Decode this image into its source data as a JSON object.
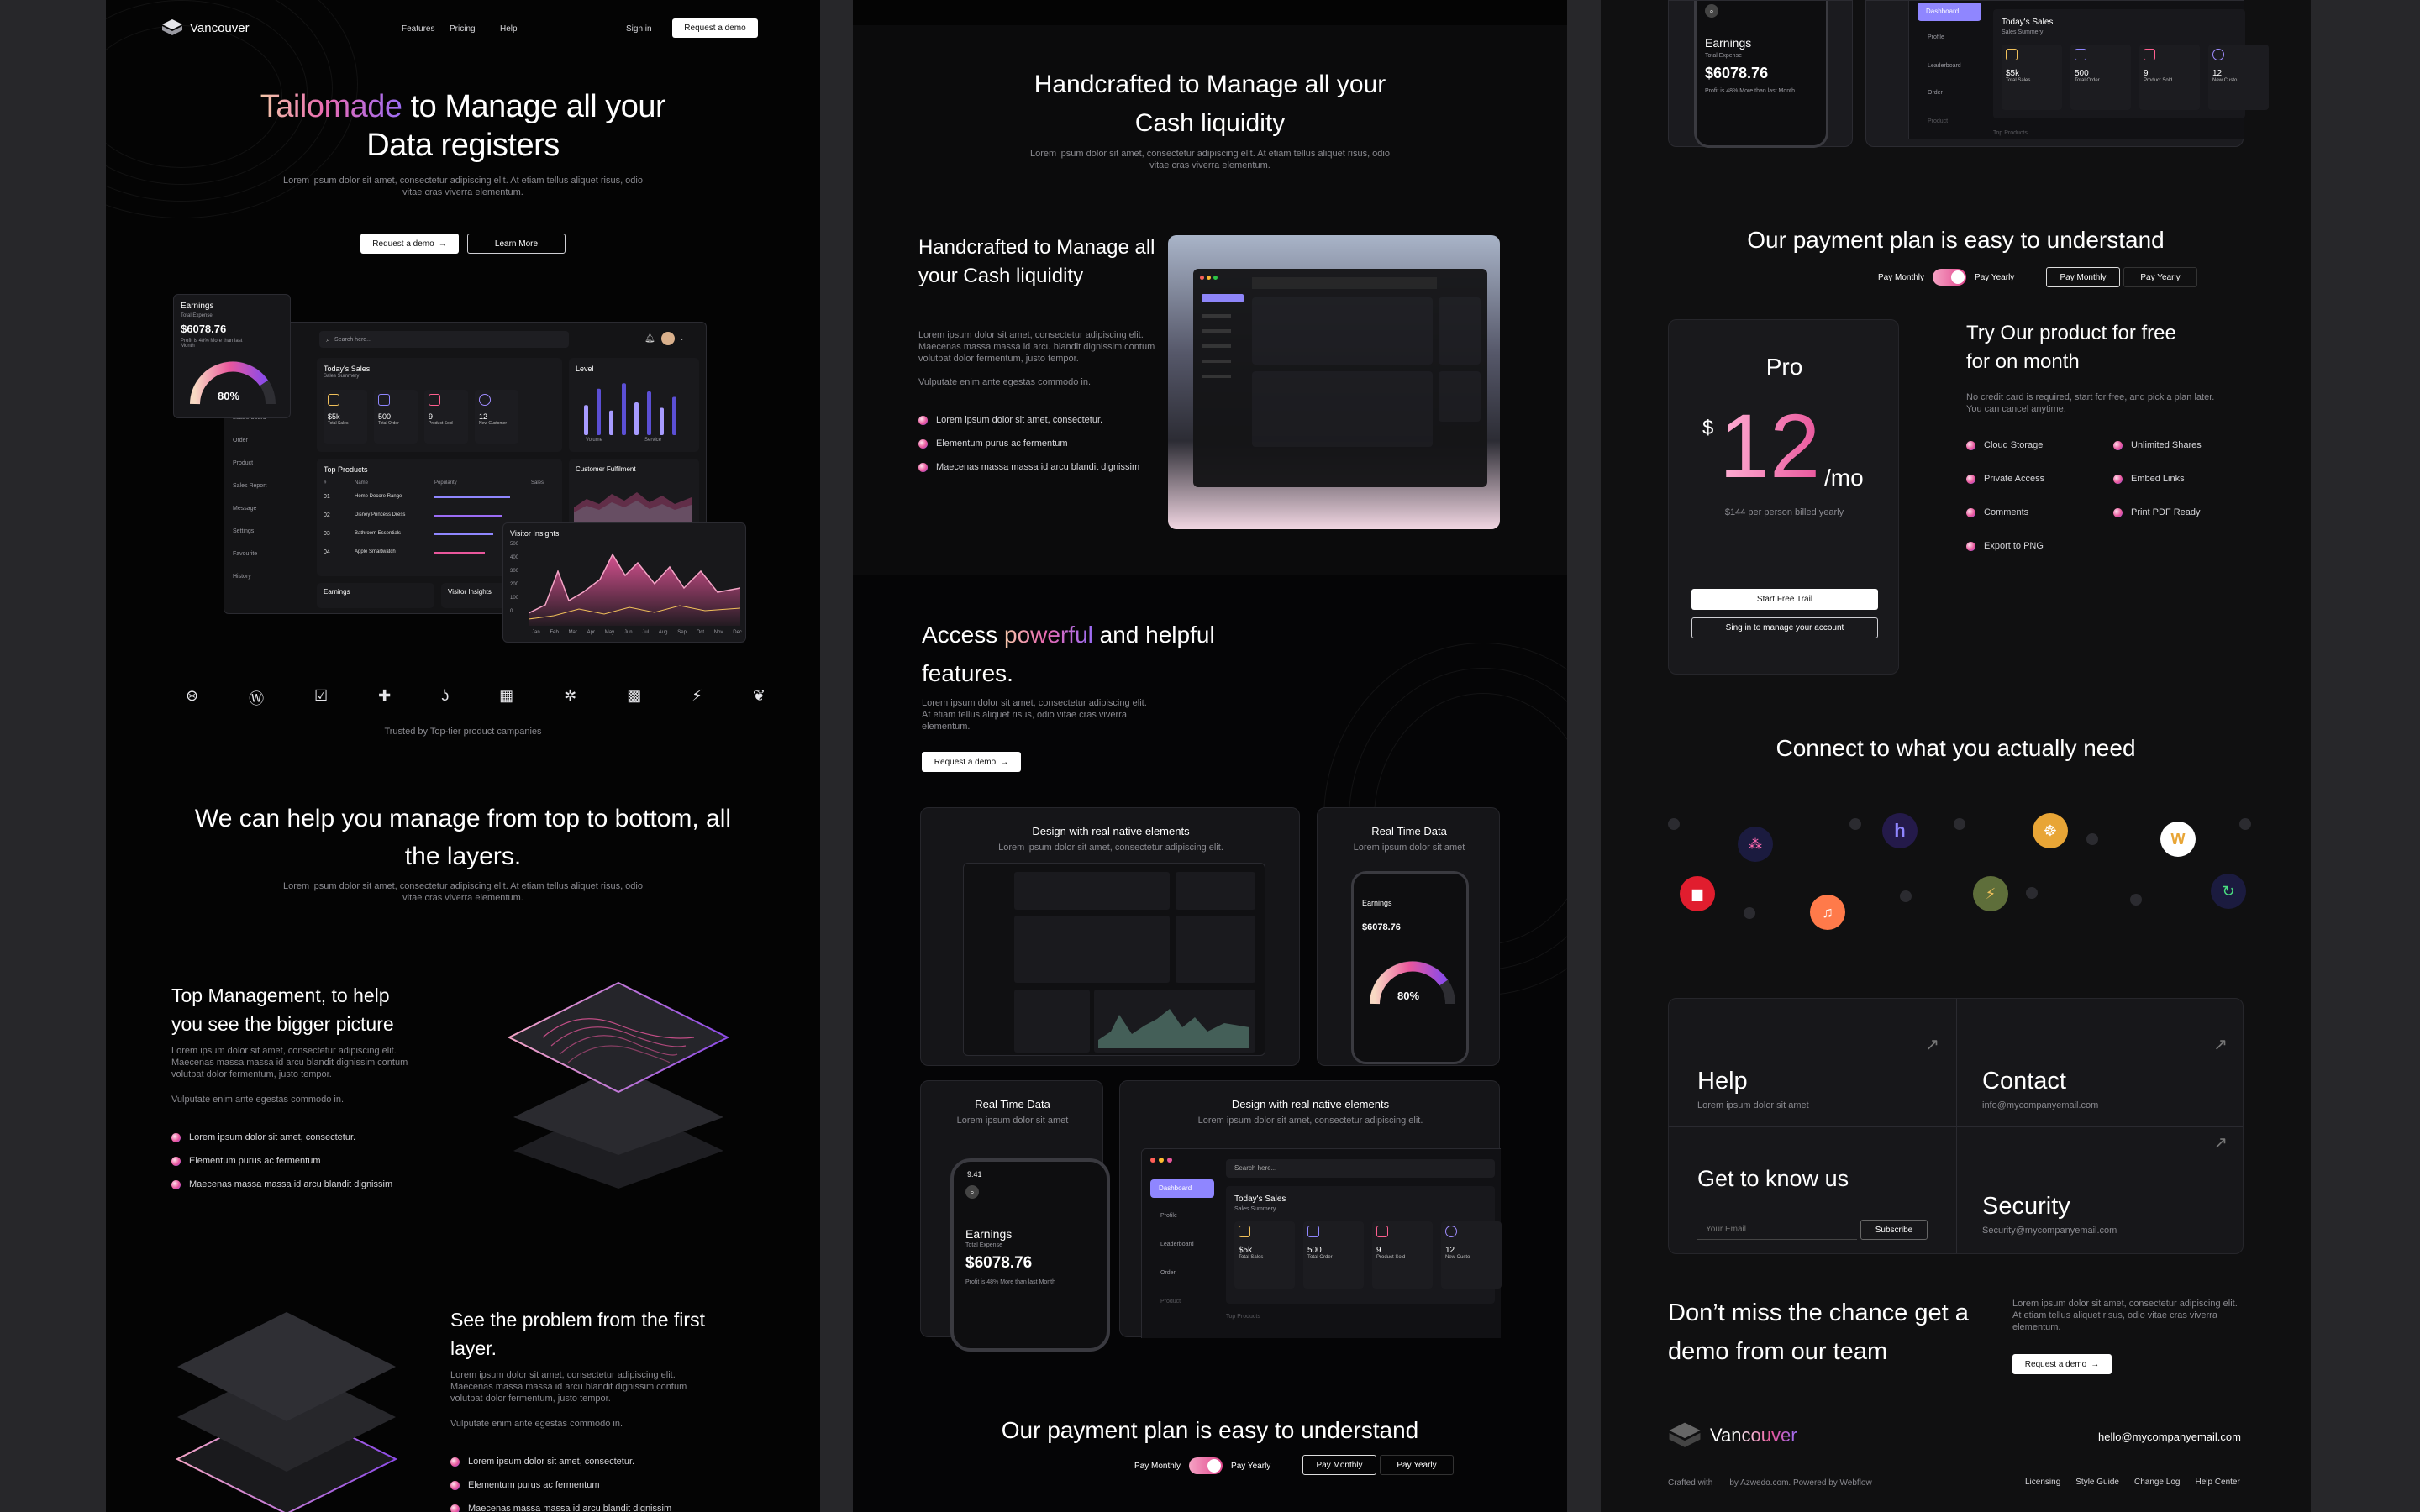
{
  "col1": {
    "nav": {
      "brand": "Vancouver",
      "links": [
        "Features",
        "Pricing",
        "Help"
      ],
      "signin": "Sign in",
      "demo": "Request a demo"
    },
    "hero": {
      "title_grad": "Tailomade",
      "title_rest1": " to Manage all your",
      "title_line2": "Data registers",
      "desc": "Lorem ipsum dolor sit amet, consectetur adipiscing elit. At etiam tellus aliquet risus, odio vitae cras viverra elementum.",
      "btn_demo": "Request a demo",
      "btn_learn": "Learn More"
    },
    "dashboard": {
      "earnings_title": "Earnings",
      "earnings_sub": "Total Expense",
      "earnings_value": "$6078.76",
      "earnings_note": "Profit is 48% More than last Month",
      "gauge": "80%",
      "search": "Search here...",
      "today_sales": "Today's Sales",
      "sales_summary": "Sales Summery",
      "stats": [
        {
          "v": "$5k",
          "l": "Total Sales"
        },
        {
          "v": "500",
          "l": "Total Order"
        },
        {
          "v": "9",
          "l": "Product Sold"
        },
        {
          "v": "12",
          "l": "New Customer"
        }
      ],
      "level": "Level",
      "level_legend": [
        "Volume",
        "Service"
      ],
      "top_products": "Top Products",
      "tp_headers": [
        "#",
        "Name",
        "Popularity",
        "Sales"
      ],
      "tp_rows": [
        {
          "n": "01",
          "name": "Home Decore Range"
        },
        {
          "n": "02",
          "name": "Disney Princess Dress"
        },
        {
          "n": "03",
          "name": "Bathroom Essentials"
        },
        {
          "n": "04",
          "name": "Apple Smartwatch"
        }
      ],
      "customer_fulfilment": "Customer Fulfilment",
      "visitor": {
        "title": "Visitor Insights",
        "y": [
          "500",
          "400",
          "300",
          "200",
          "100",
          "0"
        ],
        "months": [
          "Jan",
          "Feb",
          "Mar",
          "Apr",
          "May",
          "Jun",
          "Jul",
          "Aug",
          "Sep",
          "Oct",
          "Nov",
          "Dec"
        ]
      },
      "earnings_small": "Earnings",
      "visitor_small": "Visitor Insights",
      "sidebar": [
        "Leaderboard",
        "Order",
        "Product",
        "Sales Report",
        "Message",
        "Settings",
        "Favourite",
        "History"
      ]
    },
    "trusted": "Trusted by Top-tier product campanies",
    "help_title": "We can help you manage from top to bottom, all the layers.",
    "help_desc": "Lorem ipsum dolor sit amet, consectetur adipiscing elit. At etiam tellus aliquet risus, odio vitae cras viverra elementum.",
    "feat1": {
      "title": "Top Management, to help you see the bigger picture",
      "desc": "Lorem ipsum dolor sit amet, consectetur adipiscing elit. Maecenas massa massa id arcu blandit dignissim contum volutpat dolor fermentum, justo tempor.",
      "note": "Vulputate enim ante egestas commodo in.",
      "bullets": [
        "Lorem ipsum dolor sit amet, consectetur.",
        "Elementum purus ac fermentum",
        "Maecenas massa massa id arcu blandit dignissim"
      ]
    },
    "feat2": {
      "title": "See the problem from the first layer.",
      "desc": "Lorem ipsum dolor sit amet, consectetur adipiscing elit. Maecenas massa massa id arcu blandit dignissim contum volutpat dolor fermentum, justo tempor.",
      "note": "Vulputate enim ante egestas commodo in.",
      "bullets": [
        "Lorem ipsum dolor sit amet, consectetur.",
        "Elementum purus ac fermentum",
        "Maecenas massa massa id arcu blandit dignissim"
      ]
    }
  },
  "col2": {
    "intro_title": "Handcrafted  to Manage all your Cash liquidity",
    "intro_desc": "Lorem ipsum dolor sit amet, consectetur adipiscing elit. At etiam tellus aliquet risus, odio vitae cras viverra elementum.",
    "side_title": "Handcrafted  to Manage all your Cash liquidity",
    "side_desc": "Lorem ipsum dolor sit amet, consectetur adipiscing elit. Maecenas massa massa id arcu blandit dignissim contum volutpat dolor fermentum, justo tempor.",
    "side_note": "Vulputate enim ante egestas commodo in.",
    "side_bullets": [
      "Lorem ipsum dolor sit amet, consectetur.",
      "Elementum purus ac fermentum",
      "Maecenas massa massa id arcu blandit dignissim"
    ],
    "access": {
      "pre": "Access ",
      "grad": "powerful",
      "post": " and helpful",
      "line2": "features.",
      "desc": "Lorem ipsum dolor sit amet, consectetur adipiscing elit. At etiam tellus aliquet risus, odio vitae cras viverra elementum.",
      "btn": "Request a demo"
    },
    "cards": [
      {
        "title": "Design with real native elements",
        "sub": "Lorem ipsum dolor sit amet, consectetur adipiscing elit."
      },
      {
        "title": "Real Time Data",
        "sub": "Lorem ipsum dolor sit amet"
      },
      {
        "title": "Real Time Data",
        "sub": "Lorem ipsum dolor sit amet"
      },
      {
        "title": "Design with real native elements",
        "sub": "Lorem ipsum dolor sit amet, consectetur adipiscing elit."
      }
    ],
    "phone": {
      "time": "9:41",
      "title": "Earnings",
      "sub": "Total Expense",
      "value": "$6078.76",
      "note": "Profit is 48% More than last Month",
      "gauge": "80%"
    },
    "dash_card": {
      "menu": [
        "Dashboard",
        "Profile",
        "Leaderboard",
        "Order",
        "Product"
      ],
      "search": "Search here...",
      "today": "Today's Sales",
      "summary": "Sales Summery",
      "stats": [
        {
          "v": "$5k",
          "l": "Total Sales"
        },
        {
          "v": "500",
          "l": "Total Order"
        },
        {
          "v": "9",
          "l": "Product Sold"
        },
        {
          "v": "12",
          "l": "New Custo"
        }
      ],
      "top_products": "Top Products"
    },
    "payment": {
      "title": "Our payment plan is easy to understand",
      "monthly": "Pay Monthly",
      "yearly": "Pay Yearly"
    }
  },
  "col3": {
    "payment": {
      "title": "Our payment plan is easy to understand",
      "monthly": "Pay Monthly",
      "yearly": "Pay Yearly"
    },
    "pro": {
      "name": "Pro",
      "currency": "$",
      "price": "12",
      "per": "/mo",
      "billed": "$144 per person billed yearly",
      "start": "Start Free Trail",
      "signin": "Sing in to manage your account"
    },
    "trial": {
      "title": "Try Our product for free for on month",
      "desc": "No credit card is required, start for free, and pick a plan later. You can cancel anytime.",
      "features": [
        "Cloud Storage",
        "Unlimited Shares",
        "Private Access",
        "Embed Links",
        "Comments",
        "Print PDF Ready",
        "Export to PNG"
      ]
    },
    "connect": "Connect to what you actually need",
    "links": [
      {
        "title": "Help",
        "sub": "Lorem ipsum dolor sit amet"
      },
      {
        "title": "Contact",
        "sub": "info@mycompanyemail.com"
      },
      {
        "title": "Get to know us",
        "placeholder": "Your Email",
        "btn": "Subscribe"
      },
      {
        "title": "Security",
        "sub": "Security@mycompanyemail.com"
      }
    ],
    "cta": {
      "title": "Don’t miss the chance get a demo from our team",
      "desc": "Lorem ipsum dolor sit amet, consectetur adipiscing elit. At etiam tellus aliquet risus, odio vitae cras viverra elementum.",
      "btn": "Request a demo"
    },
    "footer": {
      "brand": "Vancouver",
      "email": "hello@mycompanyemail.com",
      "crafted": "Crafted with",
      "by": "by Azwedo.com. Powered by Webflow",
      "links": [
        "Licensing",
        "Style Guide",
        "Change Log",
        "Help Center"
      ]
    },
    "top_dash": {
      "earnings": "Earnings",
      "expense": "Total Expense",
      "value": "$6078.76",
      "note": "Profit is 48% More than last Month",
      "menu": [
        "Dashboard",
        "Profile",
        "Leaderboard",
        "Order",
        "Product"
      ],
      "today": "Today's Sales",
      "summary": "Sales Summery",
      "stats": [
        {
          "v": "$5k",
          "l": "Total Sales"
        },
        {
          "v": "500",
          "l": "Total Order"
        },
        {
          "v": "9",
          "l": "Product Sold"
        },
        {
          "v": "12",
          "l": "New Custo"
        }
      ],
      "top_products": "Top Products"
    }
  },
  "colors": {
    "accent_pink": "#e9579c",
    "accent_purple": "#9b6cf5",
    "accent_peach": "#f5c7a9"
  },
  "icons": [
    "logo-cube-icon",
    "arrow-right-icon",
    "search-icon",
    "bell-icon",
    "avatar",
    "brand-logo-icons",
    "diagonal-arrow-icon"
  ]
}
